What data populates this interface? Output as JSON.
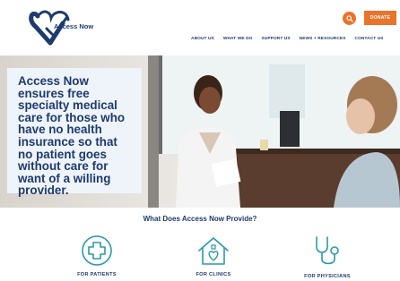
{
  "header": {
    "logo_text": "Access Now",
    "search_icon": "search-icon",
    "donate_label": "DONATE",
    "accent_color": "#e9742b",
    "brand_color": "#1f3a6e",
    "nav": [
      {
        "label": "ABOUT US"
      },
      {
        "label": "WHAT WE DO"
      },
      {
        "label": "SUPPORT US"
      },
      {
        "label": "NEWS + RESOURCES"
      },
      {
        "label": "CONTACT US"
      }
    ]
  },
  "hero": {
    "text": "Access Now ensures free specialty medical care for those who have no health insurance so that no patient goes without care for want of a willing provider."
  },
  "section": {
    "title": "What Does Access Now Provide?",
    "features": [
      {
        "icon": "medical-cross-icon",
        "label": "FOR PATIENTS"
      },
      {
        "icon": "house-heart-icon",
        "label": "FOR CLINICS"
      },
      {
        "icon": "stethoscope-icon",
        "label": "FOR PHYSICIANS"
      }
    ]
  }
}
